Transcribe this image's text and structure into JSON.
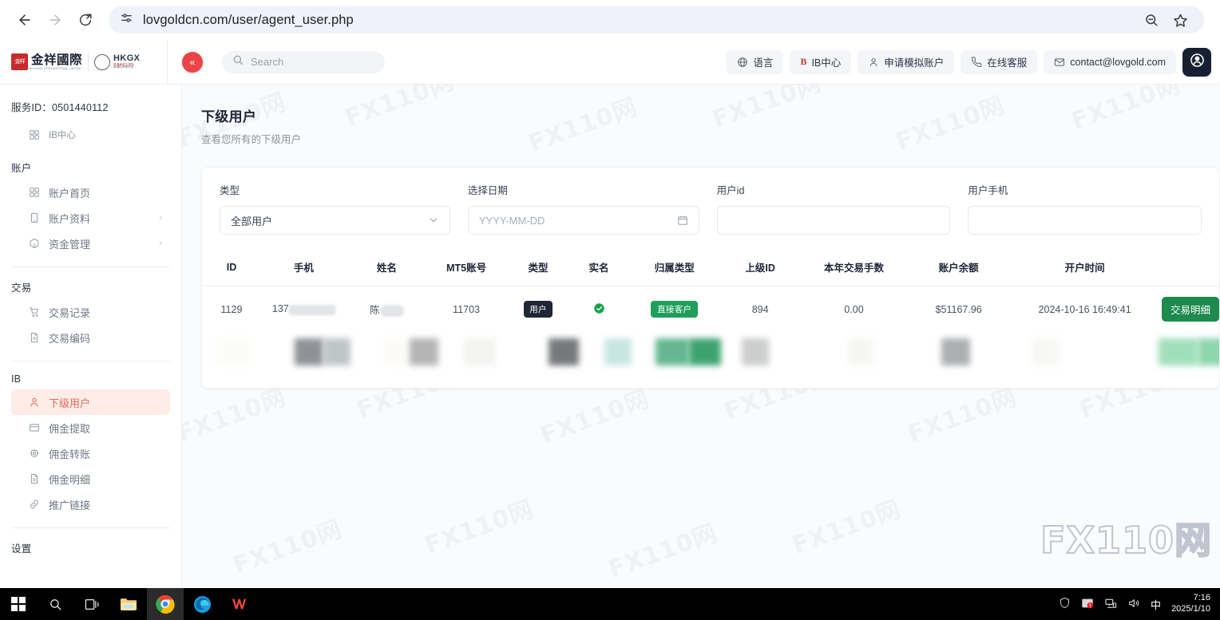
{
  "browser": {
    "url": "lovgoldcn.com/user/agent_user.php",
    "back_icon": "back-arrow-icon",
    "forward_icon": "forward-arrow-icon",
    "reload_icon": "reload-icon",
    "site_info_icon": "site-settings-icon",
    "zoom_icon": "zoom-out-icon",
    "bookmark_icon": "star-icon"
  },
  "header": {
    "logo_mark": "金祥",
    "logo_cn": "金祥國際",
    "logo_sub": "JIN XIANG INTERNATIONAL LIMITED",
    "hkgx_text": "HKGX",
    "hkgx_red": "香港黄金交易所",
    "hkgx_reg": "AA类125号行员",
    "collapse_label": "«",
    "search_placeholder": "Search",
    "actions": [
      {
        "label": "语言",
        "icon": "globe-icon"
      },
      {
        "label": "IB中心",
        "icon": "ib-icon"
      },
      {
        "label": "申请模拟账户",
        "icon": "user-icon"
      },
      {
        "label": "在线客服",
        "icon": "phone-icon"
      },
      {
        "label": "contact@lovgold.com",
        "icon": "mail-icon"
      }
    ],
    "avatar_icon": "user-avatar-icon"
  },
  "sidebar": {
    "service_id": "服务ID：0501440112",
    "top_item": {
      "label": "IB中心",
      "icon": "grid-icon"
    },
    "sections": [
      {
        "title": "账户",
        "items": [
          {
            "label": "账户首页",
            "icon": "grid-icon",
            "chevron": false,
            "active": false
          },
          {
            "label": "账户资料",
            "icon": "book-icon",
            "chevron": true,
            "active": false
          },
          {
            "label": "资金管理",
            "icon": "box-icon",
            "chevron": true,
            "active": false
          }
        ]
      },
      {
        "title": "交易",
        "items": [
          {
            "label": "交易记录",
            "icon": "cart-icon",
            "chevron": false,
            "active": false
          },
          {
            "label": "交易编码",
            "icon": "document-icon",
            "chevron": false,
            "active": false
          }
        ]
      },
      {
        "title": "IB",
        "items": [
          {
            "label": "下级用户",
            "icon": "person-icon",
            "chevron": false,
            "active": true
          },
          {
            "label": "佣金提取",
            "icon": "card-icon",
            "chevron": false,
            "active": false
          },
          {
            "label": "佣金转账",
            "icon": "transfer-icon",
            "chevron": false,
            "active": false
          },
          {
            "label": "佣金明细",
            "icon": "document-icon",
            "chevron": false,
            "active": false
          },
          {
            "label": "推广链接",
            "icon": "link-icon",
            "chevron": false,
            "active": false
          }
        ]
      },
      {
        "title": "设置",
        "items": []
      }
    ]
  },
  "main": {
    "page_title": "下级用户",
    "page_subtitle": "查看您所有的下级用户",
    "filters": [
      {
        "label": "类型",
        "value": "全部用户",
        "placeholder": "",
        "control": "select",
        "icon": "chevron-down-icon"
      },
      {
        "label": "选择日期",
        "value": "",
        "placeholder": "YYYY-MM-DD",
        "control": "date",
        "icon": "calendar-icon"
      },
      {
        "label": "用户id",
        "value": "",
        "placeholder": "",
        "control": "text",
        "icon": ""
      },
      {
        "label": "用户手机",
        "value": "",
        "placeholder": "",
        "control": "text",
        "icon": ""
      }
    ],
    "table": {
      "columns": [
        "ID",
        "手机",
        "姓名",
        "MT5账号",
        "类型",
        "实名",
        "归属类型",
        "上级ID",
        "本年交易手数",
        "账户余额",
        "开户时间",
        ""
      ],
      "rows": [
        {
          "id": "1129",
          "phone_prefix": "137",
          "phone_masked": true,
          "name_prefix": "陈",
          "name_masked": true,
          "mt5": "11703",
          "type_badge": "用户",
          "verified_icon": "check-circle-icon",
          "belong_badge": "直接客户",
          "parent_id": "894",
          "lots": "0.00",
          "balance": "$51167.96",
          "open_time": "2024-10-16 16:49:41",
          "action_label": "交易明细"
        }
      ]
    }
  },
  "watermark": {
    "text": "FX110网",
    "big_text": "FX110网"
  },
  "taskbar": {
    "items": [
      {
        "icon": "windows-start-icon",
        "active": false
      },
      {
        "icon": "search-icon",
        "active": false
      },
      {
        "icon": "task-view-icon",
        "active": false
      },
      {
        "icon": "file-explorer-icon",
        "active": false
      },
      {
        "icon": "chrome-icon",
        "active": true
      },
      {
        "icon": "edge-icon",
        "active": false
      },
      {
        "icon": "wps-icon",
        "active": false
      }
    ],
    "tray": [
      {
        "icon": "shield-icon"
      },
      {
        "icon": "security-alert-icon"
      },
      {
        "icon": "network-icon"
      },
      {
        "icon": "volume-icon"
      },
      {
        "icon": "ime-icon",
        "label": "中"
      }
    ],
    "time": "7:16",
    "date": "2025/1/10"
  },
  "colors": {
    "accent_red": "#e84545",
    "active_nav_bg": "#fdece8",
    "active_nav_text": "#e06a55",
    "badge_dark": "#1f2636",
    "badge_green": "#1e9e5a",
    "button_green": "#1e8a4d",
    "check_green": "#16a34a"
  }
}
